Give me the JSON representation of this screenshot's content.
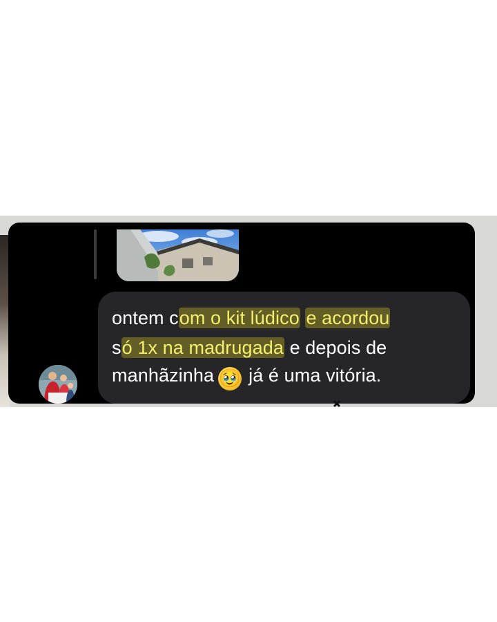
{
  "message": {
    "line1": {
      "text_plain_start": "ontem c",
      "text_highlight_1": "om o kit lúdico",
      "text_space": " ",
      "text_highlight_2": "e acordou"
    },
    "line2": {
      "text_plain_start": "s",
      "text_highlight": "ó 1x na madrugada",
      "text_plain_end": " e depois de"
    },
    "line3": {
      "text_start": "manhãzinha",
      "emoji": "🥹",
      "text_end": "já é uma vitória."
    }
  },
  "colors": {
    "panel_background": "#000000",
    "bubble_background": "#262628",
    "message_text": "#ffffff",
    "highlight_text": "#f4ee6e"
  },
  "icons": {
    "avatar": "profile-photo-avatar",
    "reply_preview": "photo-thumbnail"
  }
}
